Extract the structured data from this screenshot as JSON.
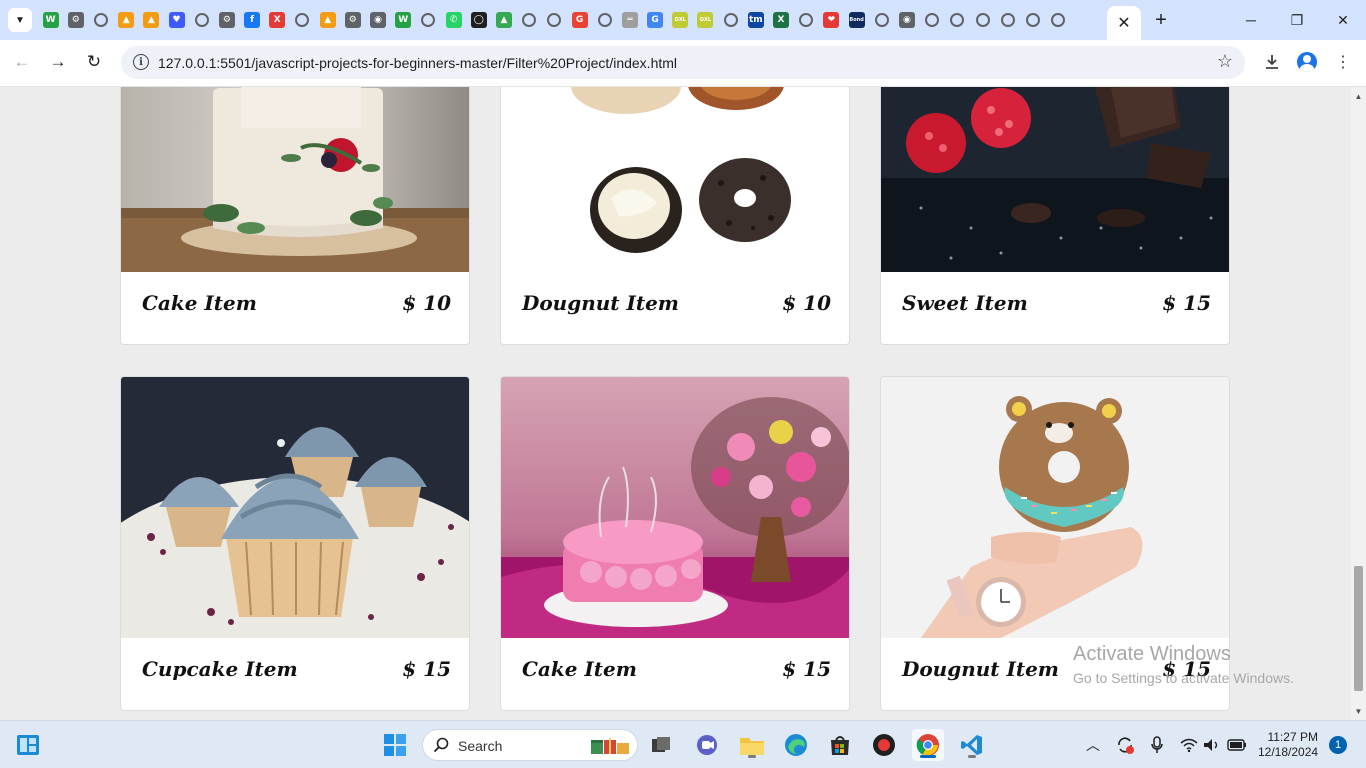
{
  "browser": {
    "url": "127.0.0.1:5501/javascript-projects-for-beginners-master/Filter%20Project/index.html",
    "pinned_tabs": [
      {
        "icon": "whatsapp-web-favicon",
        "color": "#25a244",
        "glyph": "W"
      },
      {
        "icon": "chatgpt-favicon",
        "color": "#5f6368",
        "glyph": "⚙"
      },
      {
        "icon": "generic-globe-favicon",
        "color": "#5f6368",
        "glyph": ""
      },
      {
        "icon": "vlc-favicon",
        "color": "#f39c12",
        "glyph": "▲"
      },
      {
        "icon": "vlc-favicon",
        "color": "#f39c12",
        "glyph": "▲"
      },
      {
        "icon": "heart-shield-favicon",
        "color": "#3d5afe",
        "glyph": "♥"
      },
      {
        "icon": "generic-globe-favicon",
        "color": "#5f6368",
        "glyph": ""
      },
      {
        "icon": "chatgpt-favicon",
        "color": "#5f6368",
        "glyph": "⚙"
      },
      {
        "icon": "facebook-favicon",
        "color": "#1877f2",
        "glyph": "f"
      },
      {
        "icon": "x-favicon",
        "color": "#e53935",
        "glyph": "X"
      },
      {
        "icon": "generic-globe-favicon",
        "color": "#5f6368",
        "glyph": ""
      },
      {
        "icon": "vlc-favicon",
        "color": "#f39c12",
        "glyph": "▲"
      },
      {
        "icon": "chatgpt-favicon",
        "color": "#5f6368",
        "glyph": "⚙"
      },
      {
        "icon": "chrome-favicon",
        "color": "#5f6368",
        "glyph": "◉"
      },
      {
        "icon": "whatsapp-web-favicon",
        "color": "#25a244",
        "glyph": "W"
      },
      {
        "icon": "generic-globe-favicon",
        "color": "#5f6368",
        "glyph": ""
      },
      {
        "icon": "whatsapp-favicon",
        "color": "#25d366",
        "glyph": "✆"
      },
      {
        "icon": "github-favicon",
        "color": "#1f1f1f",
        "glyph": "◯"
      },
      {
        "icon": "google-drive-favicon",
        "color": "#34a853",
        "glyph": "▲"
      },
      {
        "icon": "generic-globe-favicon",
        "color": "#5f6368",
        "glyph": ""
      },
      {
        "icon": "generic-globe-favicon",
        "color": "#5f6368",
        "glyph": ""
      },
      {
        "icon": "google-favicon",
        "color": "#ea4335",
        "glyph": "G"
      },
      {
        "icon": "generic-globe-favicon",
        "color": "#5f6368",
        "glyph": ""
      },
      {
        "icon": "ruler-favicon",
        "color": "#9e9e9e",
        "glyph": "═"
      },
      {
        "icon": "google-favicon",
        "color": "#4285f4",
        "glyph": "G"
      },
      {
        "icon": "dxl-favicon",
        "color": "#c0ca33",
        "glyph": "DXL"
      },
      {
        "icon": "dxl-favicon",
        "color": "#c0ca33",
        "glyph": "DXL"
      },
      {
        "icon": "generic-globe-favicon",
        "color": "#5f6368",
        "glyph": ""
      },
      {
        "icon": "tm-favicon",
        "color": "#0d47a1",
        "glyph": "tm"
      },
      {
        "icon": "excel-favicon",
        "color": "#1e7145",
        "glyph": "X"
      },
      {
        "icon": "generic-globe-favicon",
        "color": "#5f6368",
        "glyph": ""
      },
      {
        "icon": "heart-favicon",
        "color": "#e53935",
        "glyph": "❤"
      },
      {
        "icon": "bond-favicon",
        "color": "#0d2b5e",
        "glyph": "Bond"
      },
      {
        "icon": "generic-globe-favicon",
        "color": "#5f6368",
        "glyph": ""
      },
      {
        "icon": "chrome-favicon",
        "color": "#5f6368",
        "glyph": "◉"
      },
      {
        "icon": "generic-globe-favicon",
        "color": "#5f6368",
        "glyph": ""
      },
      {
        "icon": "generic-globe-favicon",
        "color": "#5f6368",
        "glyph": ""
      },
      {
        "icon": "generic-globe-favicon",
        "color": "#5f6368",
        "glyph": ""
      },
      {
        "icon": "generic-globe-favicon",
        "color": "#5f6368",
        "glyph": ""
      },
      {
        "icon": "generic-globe-favicon",
        "color": "#5f6368",
        "glyph": ""
      },
      {
        "icon": "generic-globe-favicon",
        "color": "#5f6368",
        "glyph": ""
      }
    ]
  },
  "products": [
    {
      "title": "Cake Item",
      "price": "$ 10",
      "image": "naked-cake-with-flowers"
    },
    {
      "title": "Dougnut Item",
      "price": "$ 10",
      "image": "doughnuts-on-white"
    },
    {
      "title": "Sweet Item",
      "price": "$ 15",
      "image": "raspberries-and-chocolate"
    },
    {
      "title": "Cupcake Item",
      "price": "$ 15",
      "image": "blue-frosted-cupcakes"
    },
    {
      "title": "Cake Item",
      "price": "$ 15",
      "image": "pink-rose-birthday-cake"
    },
    {
      "title": "Dougnut Item",
      "price": "$ 15",
      "image": "bear-doughnut-in-hand"
    }
  ],
  "watermark": {
    "title": "Activate Windows",
    "subtitle": "Go to Settings to activate Windows."
  },
  "taskbar": {
    "search_label": "Search",
    "time": "11:27 PM",
    "date": "12/18/2024",
    "notification_count": "1"
  }
}
